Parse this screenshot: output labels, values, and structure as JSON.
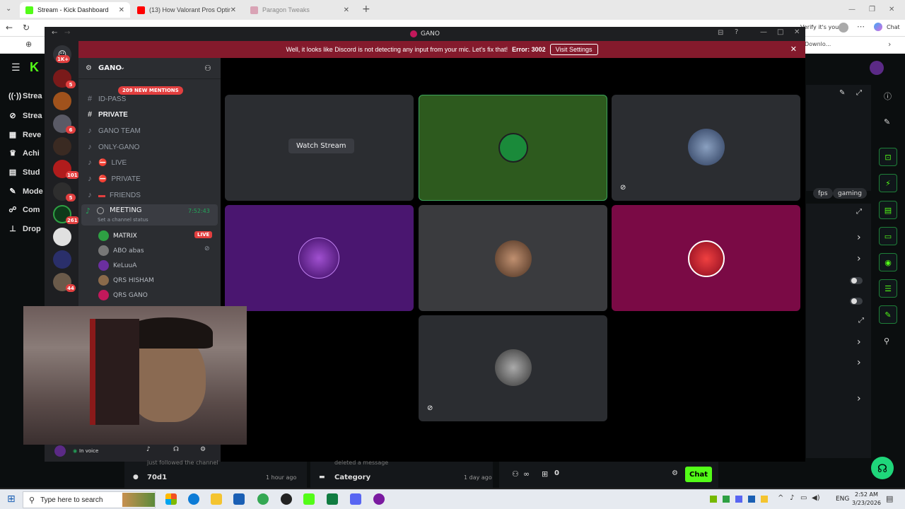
{
  "browser": {
    "tabs": [
      {
        "title": "Stream - Kick Dashboard",
        "color": "#53fc18"
      },
      {
        "title": "(13) How Valorant Pros Optimize V",
        "color": "#ff0000"
      },
      {
        "title": "Paragon Tweaks",
        "color": "#d9a3b5"
      }
    ],
    "address_right": "Verify it's you",
    "chat_label": "Chat",
    "bookmark_partial": "Downlo..."
  },
  "kick": {
    "nav": [
      "Strea",
      "Strea",
      "Reve",
      "Achi",
      "Stud",
      "Mode",
      "Com",
      "Drop"
    ],
    "nav_icons": [
      "broadcast-icon",
      "stream-icon",
      "revenue-icon",
      "trophy-icon",
      "studio-icon",
      "wrench-icon",
      "community-icon",
      "drops-icon"
    ],
    "tags": [
      "fps",
      "gaming"
    ],
    "accent": "#53fc18",
    "bottom": {
      "followed_text": "just followed the channel",
      "followed_time": "1 hour ago",
      "user": "70d1",
      "deleted_text": "deleted a message",
      "category_label": "Category",
      "category_time": "1 day ago",
      "count": "0",
      "chat_button": "Chat"
    }
  },
  "discord": {
    "window_title": "GANO",
    "banner_text": "Well, it looks like Discord is not detecting any input from your mic. Let's fix that!",
    "banner_error": "Error: 3002",
    "banner_button": "Visit Settings",
    "server_name": "GANO",
    "mentions": "209 NEW MENTIONS",
    "guild_badges": [
      "1K+",
      "5",
      "6",
      "101",
      "5",
      "261",
      "44"
    ],
    "channels": [
      {
        "name": "ID-PASS",
        "icon": "hash"
      },
      {
        "name": "PRIVATE",
        "icon": "hash"
      },
      {
        "name": "GANO TEAM",
        "icon": "speaker"
      },
      {
        "name": "ONLY-GANO",
        "icon": "speaker"
      },
      {
        "name": "LIVE",
        "icon": "speaker"
      },
      {
        "name": "PRIVATE",
        "icon": "speaker"
      },
      {
        "name": "FRIENDS",
        "icon": "speaker"
      }
    ],
    "meeting": {
      "name": "MEETING",
      "timer": "7:52:43",
      "status": "Set a channel status"
    },
    "members": [
      {
        "name": "MATRIX",
        "live": "LIVE",
        "color": "#2ea043"
      },
      {
        "name": "ABO abas",
        "color": "#777777"
      },
      {
        "name": "KeLuuA",
        "color": "#6b2fa0"
      },
      {
        "name": "QRS HISHAM",
        "color": "#8a6a4a"
      },
      {
        "name": "QRS GANO",
        "color": "#c2185b"
      }
    ],
    "user_status": "In voice",
    "watch_stream": "Watch Stream",
    "tile_colors": {
      "matrix": "#2d5a1e",
      "purple": "#4a1670",
      "grey": "#3a3b3e",
      "magenta": "#7a0a45"
    }
  },
  "taskbar": {
    "search_placeholder": "Type here to search",
    "lang": "ENG",
    "time": "2:52 AM",
    "date": "3/23/2026"
  }
}
